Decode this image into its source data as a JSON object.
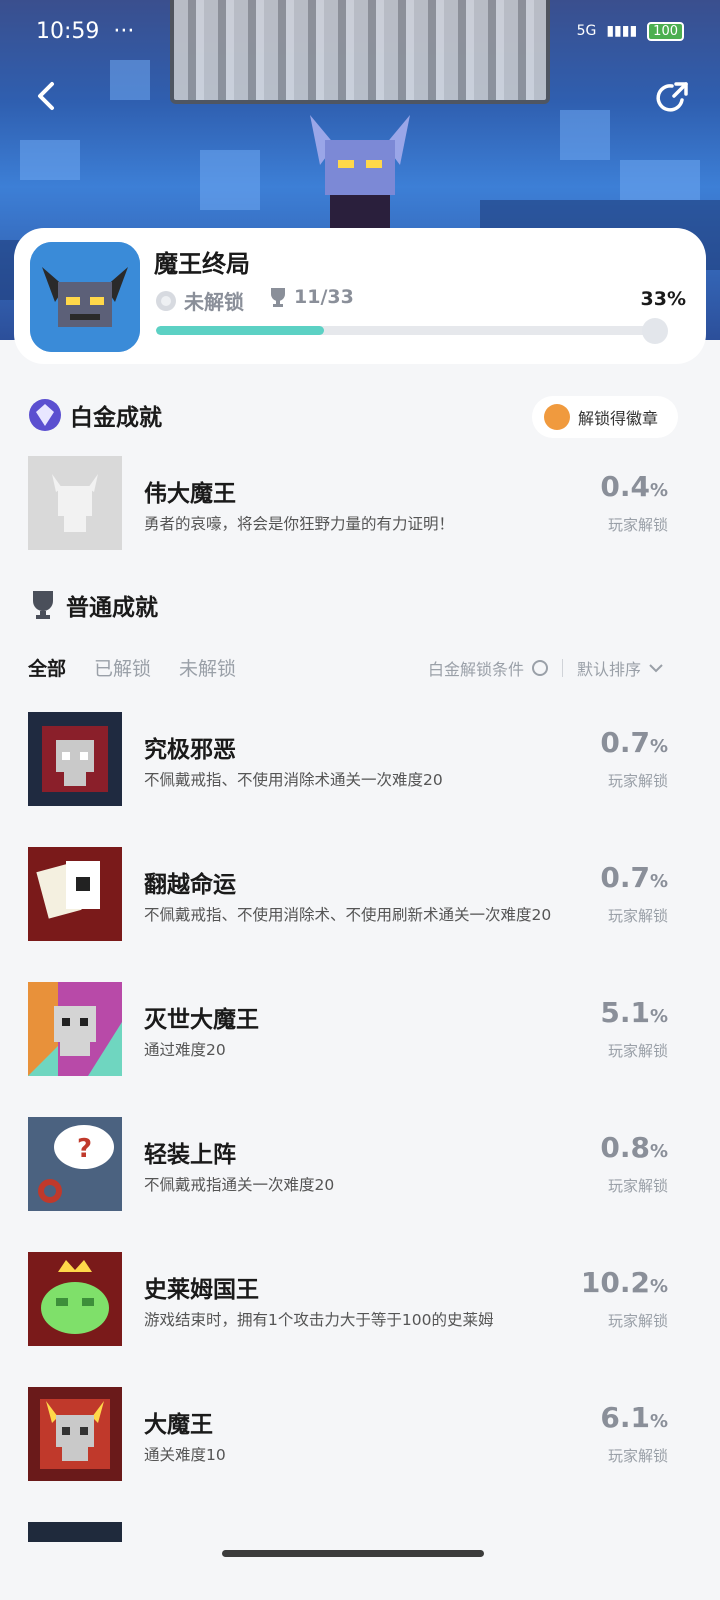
{
  "status_bar": {
    "time": "10:59",
    "dots": "···",
    "battery": "100",
    "network": "5G"
  },
  "game": {
    "title": "魔王终局",
    "lock_status": "未解锁",
    "trophy_count": "11/33",
    "progress_pct_label": "33%",
    "progress_fraction": 0.33
  },
  "platinum": {
    "section_title": "白金成就",
    "badge_pill": "解锁得徽章",
    "item": {
      "name": "伟大魔王",
      "desc": "勇者的哀嚎，将会是你狂野力量的有力证明！",
      "pct": "0.4",
      "unit": "%",
      "label": "玩家解锁"
    }
  },
  "normal": {
    "section_title": "普通成就",
    "tabs": [
      "全部",
      "已解锁",
      "未解锁"
    ],
    "filter_label": "白金解锁条件",
    "sort_label": "默认排序",
    "items": [
      {
        "name": "究极邪恶",
        "desc": "不佩戴戒指、不使用消除术通关一次难度20",
        "pct": "0.7",
        "unit": "%",
        "label": "玩家解锁"
      },
      {
        "name": "翻越命运",
        "desc": "不佩戴戒指、不使用消除术、不使用刷新术通关一次难度20",
        "pct": "0.7",
        "unit": "%",
        "label": "玩家解锁"
      },
      {
        "name": "灭世大魔王",
        "desc": "通过难度20",
        "pct": "5.1",
        "unit": "%",
        "label": "玩家解锁"
      },
      {
        "name": "轻装上阵",
        "desc": "不佩戴戒指通关一次难度20",
        "pct": "0.8",
        "unit": "%",
        "label": "玩家解锁"
      },
      {
        "name": "史莱姆国王",
        "desc": "游戏结束时，拥有1个攻击力大于等于100的史莱姆",
        "pct": "10.2",
        "unit": "%",
        "label": "玩家解锁"
      },
      {
        "name": "大魔王",
        "desc": "通关难度10",
        "pct": "6.1",
        "unit": "%",
        "label": "玩家解锁"
      }
    ]
  },
  "colors": {
    "accent": "#5cd1c4",
    "muted": "#8a8f99",
    "bg": "#f5f6f8"
  }
}
